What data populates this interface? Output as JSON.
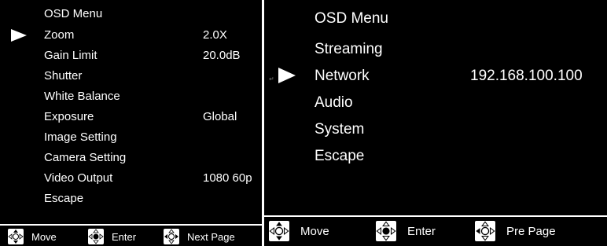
{
  "left_menu": {
    "title": "OSD Menu",
    "selected_index": 0,
    "items": [
      {
        "label": "Zoom",
        "value": "2.0X"
      },
      {
        "label": "Gain Limit",
        "value": "20.0dB"
      },
      {
        "label": "Shutter",
        "value": ""
      },
      {
        "label": "White Balance",
        "value": ""
      },
      {
        "label": "Exposure",
        "value": "Global"
      },
      {
        "label": "Image Setting",
        "value": ""
      },
      {
        "label": "Camera Setting",
        "value": ""
      },
      {
        "label": "Video Output",
        "value": "1080 60p"
      },
      {
        "label": "Escape",
        "value": ""
      }
    ],
    "footer": [
      {
        "icon": "dpad-updown-icon",
        "label": "Move"
      },
      {
        "icon": "dpad-center-icon",
        "label": "Enter"
      },
      {
        "icon": "dpad-leftright-icon",
        "label": "Next Page"
      }
    ]
  },
  "right_menu": {
    "title": "OSD Menu",
    "selected_index": 1,
    "items": [
      {
        "label": "Streaming",
        "value": ""
      },
      {
        "label": "Network",
        "value": "192.168.100.100"
      },
      {
        "label": "Audio",
        "value": ""
      },
      {
        "label": "System",
        "value": ""
      },
      {
        "label": "Escape",
        "value": ""
      }
    ],
    "footer": [
      {
        "icon": "dpad-updown-icon",
        "label": "Move"
      },
      {
        "icon": "dpad-center-icon",
        "label": "Enter"
      },
      {
        "icon": "dpad-leftright-icon",
        "label": "Pre Page"
      }
    ]
  },
  "colors": {
    "background": "#000000",
    "text": "#ffffff",
    "divider": "#ffffff"
  }
}
